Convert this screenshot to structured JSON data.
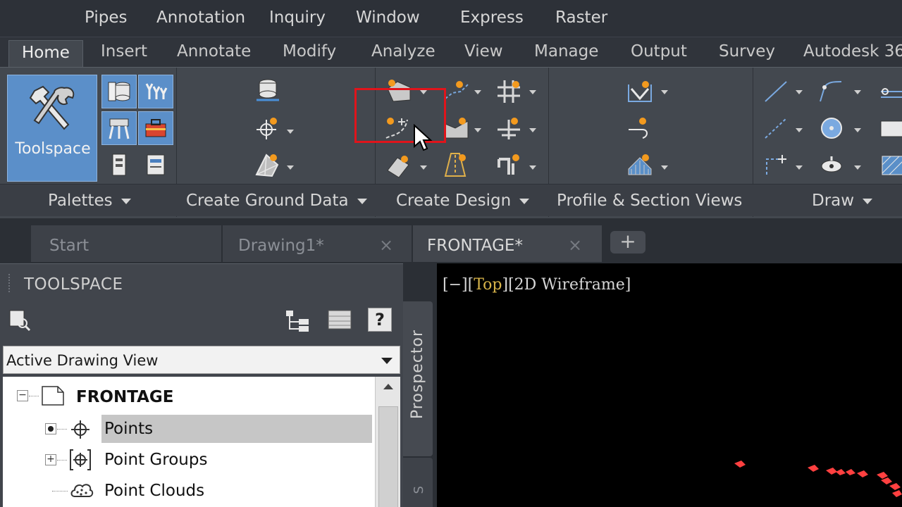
{
  "menu": {
    "items": [
      "Pipes",
      "Annotation",
      "Inquiry",
      "Window",
      "Express",
      "Raster"
    ]
  },
  "ribbon_tabs": {
    "items": [
      "Home",
      "Insert",
      "Annotate",
      "Modify",
      "Analyze",
      "View",
      "Manage",
      "Output",
      "Survey",
      "Autodesk 36"
    ],
    "active": "Home"
  },
  "panels": {
    "palettes": "Palettes",
    "create_ground_data": "Create Ground Data",
    "create_design": "Create Design",
    "profile_section_views": "Profile & Section Views",
    "draw": "Draw"
  },
  "toolspace_button": {
    "label": "Toolspace"
  },
  "doc_tabs": {
    "start": "Start",
    "drawing1": "Drawing1*",
    "frontage": "FRONTAGE*",
    "close_glyph": "×",
    "new_tab_glyph": "+"
  },
  "toolspace_palette": {
    "header": "TOOLSPACE",
    "view_select": "Active Drawing View",
    "help_glyph": "?",
    "tree": {
      "root": "FRONTAGE",
      "items": [
        "Points",
        "Point Groups",
        "Point Clouds"
      ],
      "selected": "Points"
    },
    "side_tab": "Prospector",
    "side_tab2": "S"
  },
  "viewport": {
    "control_prefix": "[−][",
    "control_view": "Top",
    "control_suffix": "][2D Wireframe]"
  },
  "colors": {
    "accent_blue": "#5b8fc9",
    "highlight_red": "#e0141b",
    "orange_icon": "#f39a1e",
    "point_red": "#ff4040"
  }
}
